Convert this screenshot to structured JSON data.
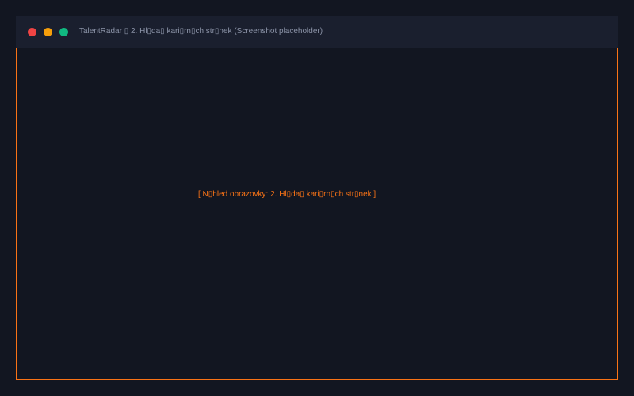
{
  "window": {
    "title": "TalentRadar ▯ 2. Hl▯da▯ kari▯rn▯ch str▯nek (Screenshot placeholder)",
    "controls": {
      "close_color": "#ef4444",
      "minimize_color": "#f59e0b",
      "maximize_color": "#10b981"
    }
  },
  "content": {
    "placeholder_text": "[ N▯hled obrazovky: 2. Hl▯da▯ kari▯rn▯ch str▯nek ]",
    "accent_color": "#f97316"
  }
}
